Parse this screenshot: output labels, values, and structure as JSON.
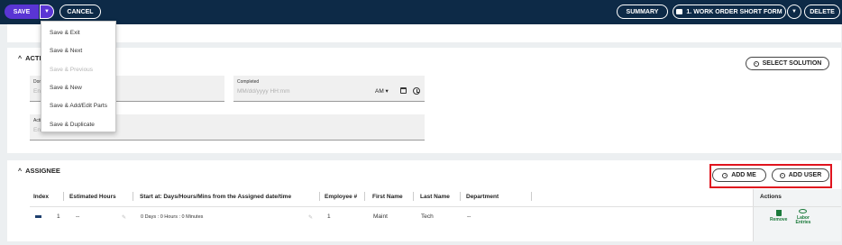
{
  "toolbar": {
    "save_label": "SAVE",
    "cancel_label": "CANCEL",
    "summary_label": "SUMMARY",
    "work_order_form_label": "1. WORK ORDER SHORT FORM",
    "delete_label": "DELETE"
  },
  "save_menu": {
    "items": [
      {
        "label": "Save & Exit",
        "enabled": true
      },
      {
        "label": "Save & Next",
        "enabled": true
      },
      {
        "label": "Save & Previous",
        "enabled": false
      },
      {
        "label": "Save & New",
        "enabled": true
      },
      {
        "label": "Save & Add/Edit Parts",
        "enabled": true
      },
      {
        "label": "Save & Duplicate",
        "enabled": true
      }
    ]
  },
  "action_section": {
    "title": "ACTION",
    "select_solution_label": "SELECT SOLUTION",
    "done_field": {
      "label": "Done",
      "placeholder": "Enter"
    },
    "completed_field": {
      "label": "Completed",
      "placeholder": "MM/dd/yyyy HH:mm",
      "ampm": "AM"
    },
    "action_field": {
      "label": "Action",
      "placeholder": "Enter"
    }
  },
  "assignee_section": {
    "title": "ASSIGNEE",
    "add_me_label": "ADD ME",
    "add_user_label": "ADD USER",
    "columns": [
      "Index",
      "Estimated Hours",
      "Start at: Days/Hours/Mins from the Assigned date/time",
      "Employee #",
      "First Name",
      "Last Name",
      "Department",
      "Actions"
    ],
    "rows": [
      {
        "index": "1",
        "estimated_hours": "--",
        "start_at": "0 Days : 0 Hours : 0 Minutes",
        "employee_no": "1",
        "first_name": "Maint",
        "last_name": "Tech",
        "department": "--",
        "remove_label": "Remove",
        "labor_entries_label": "Labor Entries"
      }
    ]
  },
  "colors": {
    "topbar": "#0d2a47",
    "primary": "#5a35d4",
    "highlight": "#e0141e",
    "action_green": "#1b7a3b"
  }
}
